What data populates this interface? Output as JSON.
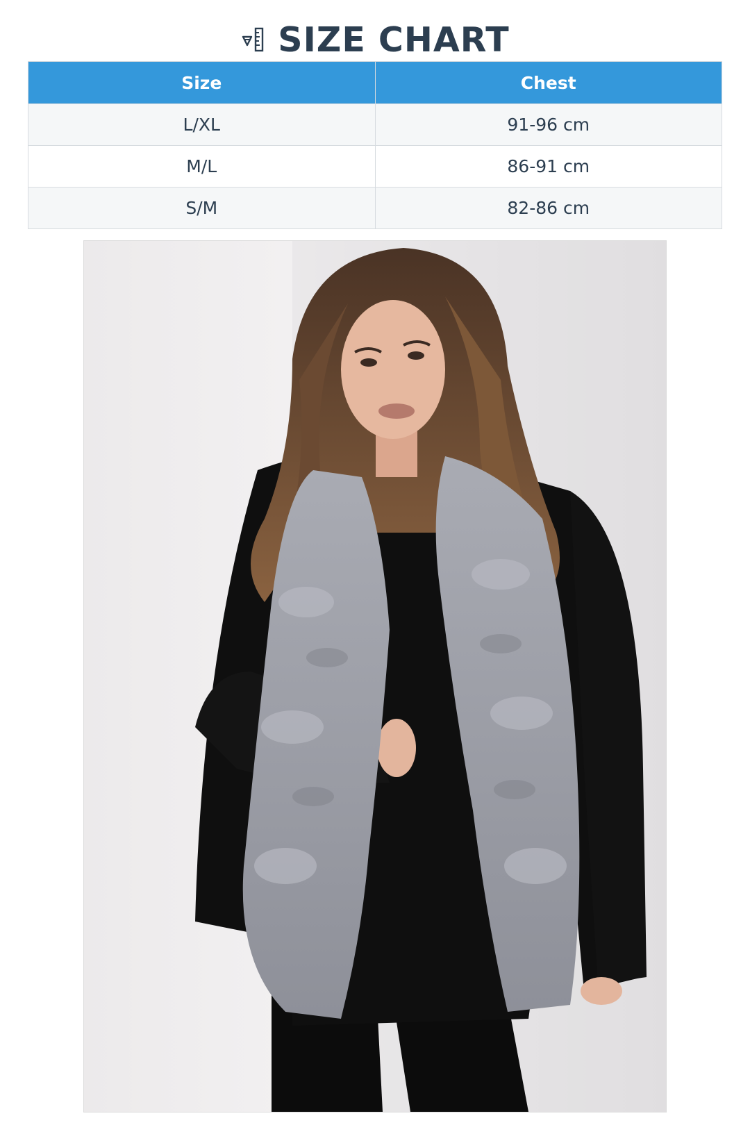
{
  "header": {
    "title": "SIZE CHART",
    "icon": "ruler-icon"
  },
  "size_table": {
    "headers": [
      "Size",
      "Chest"
    ],
    "rows": [
      {
        "size": "L/XL",
        "chest": "91-96 cm"
      },
      {
        "size": "M/L",
        "chest": "86-91 cm"
      },
      {
        "size": "S/M",
        "chest": "82-86 cm"
      }
    ]
  },
  "colors": {
    "header_bg": "#3498db",
    "title_color": "#2c3e50",
    "row_alt_bg": "#f5f7f8"
  },
  "product_photo": {
    "icon": "product-photo"
  }
}
